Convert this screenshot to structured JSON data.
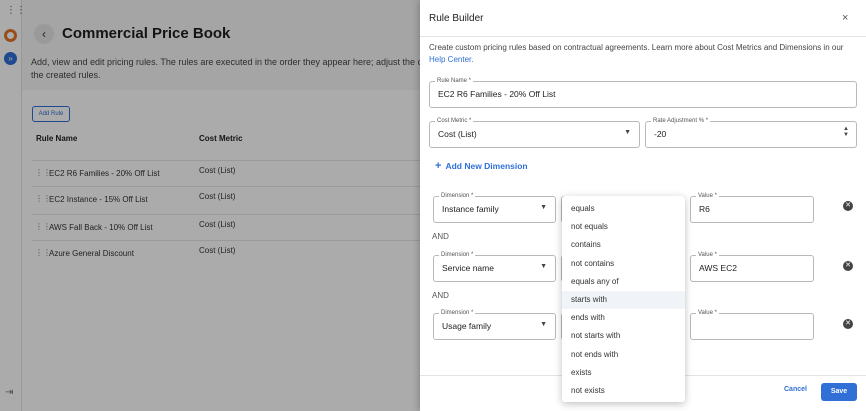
{
  "rail": {
    "grid_icon": "grid-icon",
    "logo_icon": "logo-icon",
    "nav_icon": "chevron-double-right-icon",
    "logout_icon": "logout-icon"
  },
  "page": {
    "title": "Commercial Price Book",
    "description": "Add, view and edit pricing rules. The rules are executed in the order they appear here; adjust the or the created rules.",
    "add_rule_label": "Add Rule",
    "columns": [
      "Rule Name",
      "Cost Metric"
    ],
    "rows": [
      {
        "name": "EC2 R6 Families - 20% Off List",
        "metric": "Cost (List)"
      },
      {
        "name": "EC2 Instance - 15% Off List",
        "metric": "Cost (List)"
      },
      {
        "name": "AWS Fall Back - 10% Off List",
        "metric": "Cost (List)"
      },
      {
        "name": "Azure General Discount",
        "metric": "Cost (List)"
      }
    ]
  },
  "drawer": {
    "title": "Rule Builder",
    "close_symbol": "×",
    "description": "Create custom pricing rules based on contractual agreements. Learn more about Cost Metrics and Dimensions in our",
    "help_link": "Help Center.",
    "rule_name": {
      "label": "Rule Name *",
      "value": "EC2 R6 Families - 20% Off List"
    },
    "cost_metric": {
      "label": "Cost Metric *",
      "value": "Cost (List)"
    },
    "rate_adjustment": {
      "label": "Rate Adjustment % *",
      "value": "-20"
    },
    "add_dimension_label": "Add New Dimension",
    "and_label": "AND",
    "dimensions": [
      {
        "dim_label": "Dimension *",
        "dim_value": "Instance family",
        "value_label": "Value *",
        "value": "R6"
      },
      {
        "dim_label": "Dimension *",
        "dim_value": "Service name",
        "value_label": "Value *",
        "value": "AWS EC2"
      },
      {
        "dim_label": "Dimension *",
        "dim_value": "Usage family",
        "value_label": "Value *",
        "value": ""
      }
    ],
    "cancel_label": "Cancel",
    "save_label": "Save"
  },
  "operator_menu": {
    "options": [
      "equals",
      "not equals",
      "contains",
      "not contains",
      "equals any of",
      "starts with",
      "ends with",
      "not starts with",
      "not ends with",
      "exists",
      "not exists"
    ],
    "highlighted": "starts with"
  },
  "colors": {
    "accent": "#2f6fd6",
    "logo": "#e3752b"
  }
}
